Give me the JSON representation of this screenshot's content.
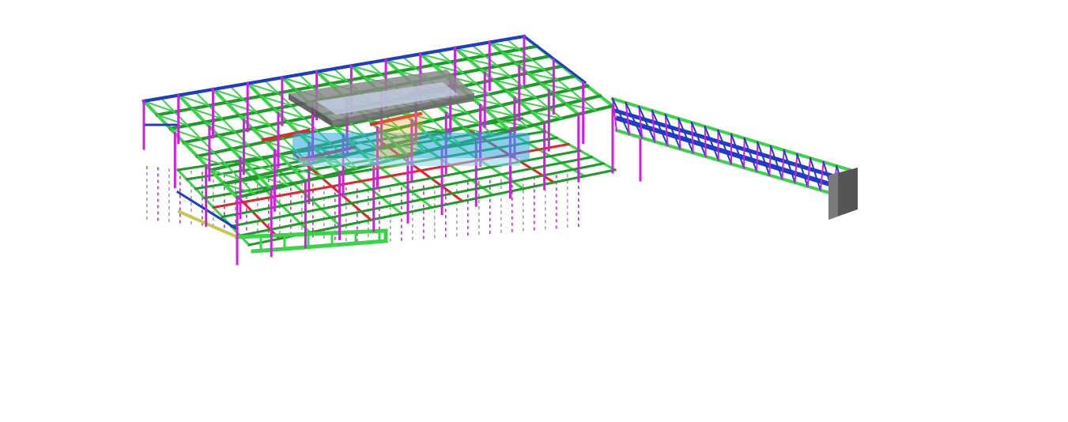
{
  "scene": {
    "description_visible_text": "",
    "colors": {
      "beam": "#39d447",
      "beam_dark": "#1f9a2a",
      "column": "#d21ee0",
      "edge_beam": "#1e3cc8",
      "red_beam": "#e0262e",
      "wall": "#8a8a8a",
      "wall_dark": "#555555",
      "bolt": "#9aa0b4",
      "bolt_accent": "#e2692a",
      "watermark": "#2aa8e0",
      "watermark_accent": "#f0a030"
    }
  }
}
